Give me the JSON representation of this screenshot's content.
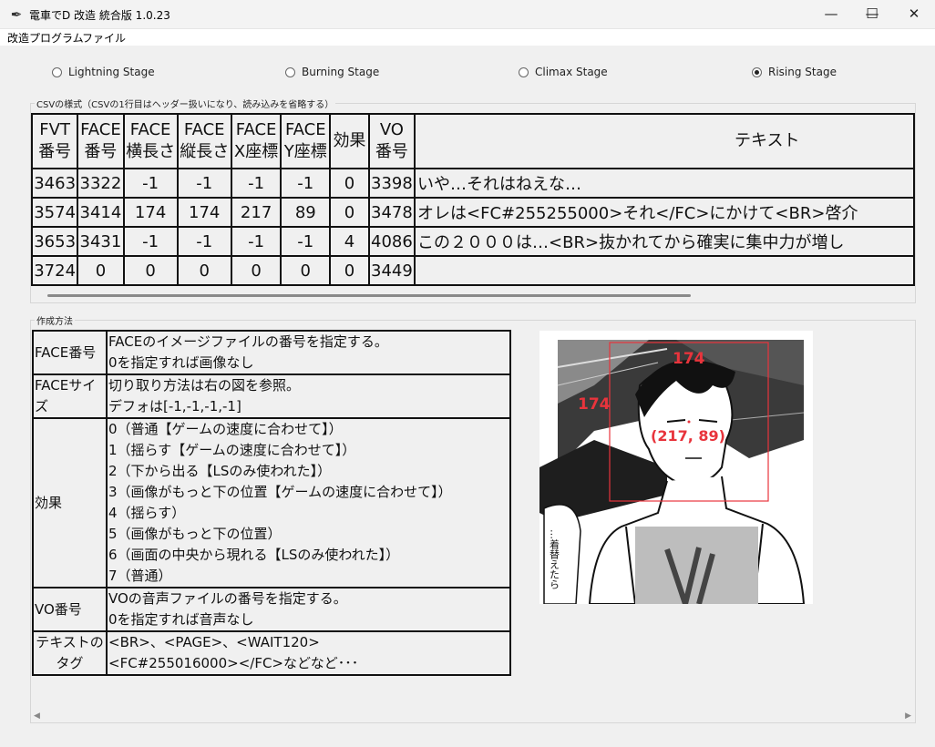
{
  "window": {
    "title": "電車でD 改造 統合版 1.0.23",
    "icon": "feather-icon",
    "minimize": "—",
    "maximize": "☐",
    "close": "✕"
  },
  "menu": [
    "改造プログラム",
    "ファイル"
  ],
  "stages": {
    "options": [
      "Lightning Stage",
      "Burning Stage",
      "Climax Stage",
      "Rising Stage"
    ],
    "selected": "Rising Stage"
  },
  "csv": {
    "label": "CSVの様式（CSVの1行目はヘッダー扱いになり、読み込みを省略する）",
    "headers": [
      [
        "FVT",
        "番号"
      ],
      [
        "FACE",
        "番号"
      ],
      [
        "FACE",
        "横長さ"
      ],
      [
        "FACE",
        "縦長さ"
      ],
      [
        "FACE",
        "X座標"
      ],
      [
        "FACE",
        "Y座標"
      ],
      [
        "効果",
        ""
      ],
      [
        "VO",
        "番号"
      ],
      [
        "テキスト",
        ""
      ]
    ],
    "rows": [
      [
        "3463",
        "3322",
        "-1",
        "-1",
        "-1",
        "-1",
        "0",
        "3398",
        "いや…それはねえな…"
      ],
      [
        "3574",
        "3414",
        "174",
        "174",
        "217",
        "89",
        "0",
        "3478",
        "オレは<FC#255255000>それ</FC>にかけて<BR>啓介"
      ],
      [
        "3653",
        "3431",
        "-1",
        "-1",
        "-1",
        "-1",
        "4",
        "4086",
        "この２０００は…<BR>抜かれてから確実に集中力が増し"
      ],
      [
        "3724",
        "0",
        "0",
        "0",
        "0",
        "0",
        "0",
        "3449",
        ""
      ]
    ]
  },
  "method": {
    "label": "作成方法",
    "rows": [
      {
        "key": [
          "FACE番号"
        ],
        "lines": [
          "FACEのイメージファイルの番号を指定する。",
          "0を指定すれば画像なし"
        ]
      },
      {
        "key": [
          "FACEサイズ"
        ],
        "lines": [
          "切り取り方法は右の図を参照。",
          "デフォは[-1,-1,-1,-1]"
        ]
      },
      {
        "key": [
          "効果"
        ],
        "lines": [
          "0（普通【ゲームの速度に合わせて】）",
          "1（揺らす【ゲームの速度に合わせて】）",
          "2（下から出る【LSのみ使われた】）",
          "3（画像がもっと下の位置【ゲームの速度に合わせて】）",
          "4（揺らす）",
          "5（画像がもっと下の位置）",
          "6（画面の中央から現れる【LSのみ使われた】）",
          "7（普通）"
        ]
      },
      {
        "key": [
          "VO番号"
        ],
        "lines": [
          "VOの音声ファイルの番号を指定する。",
          "0を指定すれば音声なし"
        ]
      },
      {
        "key": [
          "テキストの",
          "タグ"
        ],
        "lines": [
          "<BR>、<PAGE>、<WAIT120>",
          "<FC#255016000></FC>などなど･･･"
        ]
      }
    ]
  },
  "figure": {
    "width_label": "174",
    "height_label": "174",
    "coord_label": "(217, 89)",
    "side_text": "…着替えたら",
    "rect_color": "#e8343c"
  }
}
